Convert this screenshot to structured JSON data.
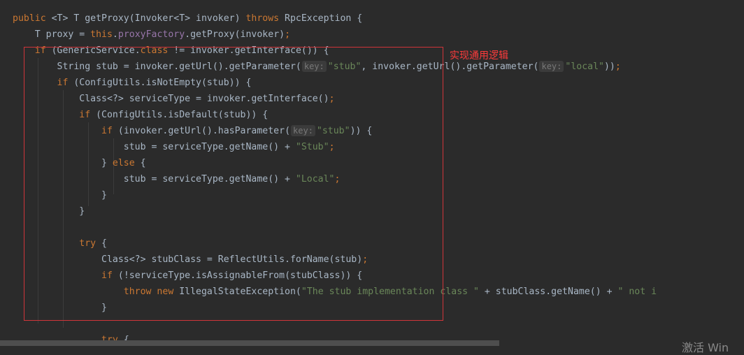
{
  "annotation": {
    "label": "实现通用逻辑",
    "box_color": "#d0353a",
    "label_color": "#ff3b3b"
  },
  "theme": {
    "background": "#2b2b2b",
    "keyword": "#cc7832",
    "string": "#6a8759",
    "field": "#9876aa",
    "text": "#a9b7c6"
  },
  "code": {
    "lines": [
      {
        "tokens": [
          {
            "t": "public",
            "c": "kw"
          },
          {
            "t": " <T> T getProxy(Invoker<T> invoker) ",
            "c": "plain"
          },
          {
            "t": "throws",
            "c": "kw"
          },
          {
            "t": " RpcException {",
            "c": "plain"
          }
        ]
      },
      {
        "tokens": [
          {
            "t": "    T proxy = ",
            "c": "plain"
          },
          {
            "t": "this",
            "c": "kw"
          },
          {
            "t": ".",
            "c": "plain"
          },
          {
            "t": "proxyFactory",
            "c": "fld"
          },
          {
            "t": ".getProxy(invoker)",
            "c": "plain"
          },
          {
            "t": ";",
            "c": "kw"
          }
        ]
      },
      {
        "tokens": [
          {
            "t": "    ",
            "c": "plain"
          },
          {
            "t": "if",
            "c": "kw"
          },
          {
            "t": " (GenericService.",
            "c": "plain"
          },
          {
            "t": "class",
            "c": "kw"
          },
          {
            "t": " != invoker.getInterface()) {",
            "c": "plain"
          }
        ]
      },
      {
        "tokens": [
          {
            "t": "        String stub = invoker.getUrl().getParameter(",
            "c": "plain"
          },
          {
            "t": "key:",
            "c": "hint"
          },
          {
            "t": "\"stub\"",
            "c": "str"
          },
          {
            "t": ", invoker.getUrl().getParameter(",
            "c": "plain"
          },
          {
            "t": "key:",
            "c": "hint"
          },
          {
            "t": "\"local\"",
            "c": "str"
          },
          {
            "t": "))",
            "c": "plain"
          },
          {
            "t": ";",
            "c": "kw"
          }
        ]
      },
      {
        "tokens": [
          {
            "t": "        ",
            "c": "plain"
          },
          {
            "t": "if",
            "c": "kw"
          },
          {
            "t": " (ConfigUtils.isNotEmpty(stub)) {",
            "c": "plain"
          }
        ]
      },
      {
        "tokens": [
          {
            "t": "            Class<?> serviceType = invoker.getInterface()",
            "c": "plain"
          },
          {
            "t": ";",
            "c": "kw"
          }
        ]
      },
      {
        "tokens": [
          {
            "t": "            ",
            "c": "plain"
          },
          {
            "t": "if",
            "c": "kw"
          },
          {
            "t": " (ConfigUtils.isDefault(stub)) {",
            "c": "plain"
          }
        ]
      },
      {
        "tokens": [
          {
            "t": "                ",
            "c": "plain"
          },
          {
            "t": "if",
            "c": "kw"
          },
          {
            "t": " (invoker.getUrl().hasParameter(",
            "c": "plain"
          },
          {
            "t": "key:",
            "c": "hint"
          },
          {
            "t": "\"stub\"",
            "c": "str"
          },
          {
            "t": ")) {",
            "c": "plain"
          }
        ]
      },
      {
        "tokens": [
          {
            "t": "                    stub = serviceType.getName() + ",
            "c": "plain"
          },
          {
            "t": "\"Stub\"",
            "c": "str"
          },
          {
            "t": ";",
            "c": "kw"
          }
        ]
      },
      {
        "tokens": [
          {
            "t": "                } ",
            "c": "plain"
          },
          {
            "t": "else",
            "c": "kw"
          },
          {
            "t": " {",
            "c": "plain"
          }
        ]
      },
      {
        "tokens": [
          {
            "t": "                    stub = serviceType.getName() + ",
            "c": "plain"
          },
          {
            "t": "\"Local\"",
            "c": "str"
          },
          {
            "t": ";",
            "c": "kw"
          }
        ]
      },
      {
        "tokens": [
          {
            "t": "                }",
            "c": "plain"
          }
        ]
      },
      {
        "tokens": [
          {
            "t": "            }",
            "c": "plain"
          }
        ]
      },
      {
        "tokens": []
      },
      {
        "tokens": [
          {
            "t": "            ",
            "c": "plain"
          },
          {
            "t": "try",
            "c": "kw"
          },
          {
            "t": " {",
            "c": "plain"
          }
        ]
      },
      {
        "tokens": [
          {
            "t": "                Class<?> stubClass = ReflectUtils.forName(stub)",
            "c": "plain"
          },
          {
            "t": ";",
            "c": "kw"
          }
        ]
      },
      {
        "tokens": [
          {
            "t": "                ",
            "c": "plain"
          },
          {
            "t": "if",
            "c": "kw"
          },
          {
            "t": " (!serviceType.isAssignableFrom(stubClass)) {",
            "c": "plain"
          }
        ]
      },
      {
        "tokens": [
          {
            "t": "                    ",
            "c": "plain"
          },
          {
            "t": "throw new",
            "c": "kw"
          },
          {
            "t": " IllegalStateException(",
            "c": "plain"
          },
          {
            "t": "\"The stub implementation class \"",
            "c": "str"
          },
          {
            "t": " + stubClass.getName() + ",
            "c": "plain"
          },
          {
            "t": "\" not i",
            "c": "str"
          }
        ]
      },
      {
        "tokens": [
          {
            "t": "                }",
            "c": "plain"
          }
        ]
      },
      {
        "tokens": []
      },
      {
        "tokens": [
          {
            "t": "                ",
            "c": "plain"
          },
          {
            "t": "try",
            "c": "kw"
          },
          {
            "t": " {",
            "c": "plain"
          }
        ]
      }
    ]
  },
  "watermark": {
    "text": "激活 Win"
  }
}
